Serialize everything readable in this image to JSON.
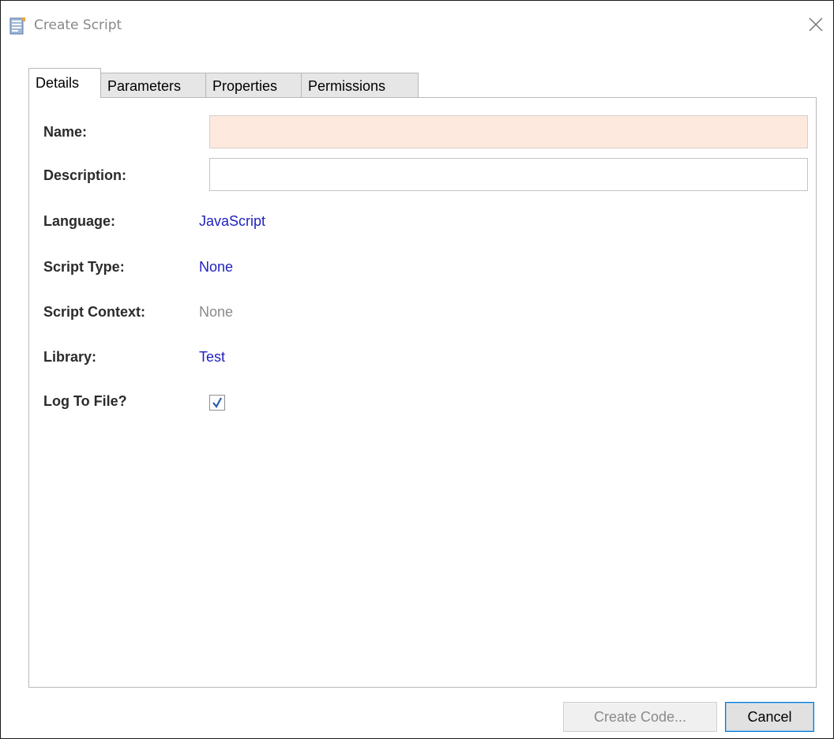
{
  "window": {
    "title": "Create Script"
  },
  "tabs": [
    "Details",
    "Parameters",
    "Properties",
    "Permissions"
  ],
  "active_tab": "Details",
  "form": {
    "name": {
      "label": "Name:",
      "value": ""
    },
    "description": {
      "label": "Description:",
      "value": ""
    },
    "language": {
      "label": "Language:",
      "value": "JavaScript"
    },
    "script_type": {
      "label": "Script Type:",
      "value": "None"
    },
    "script_context": {
      "label": "Script Context:",
      "value": "None"
    },
    "library": {
      "label": "Library:",
      "value": "Test"
    },
    "log_to_file": {
      "label": "Log To File?",
      "checked": true
    }
  },
  "buttons": {
    "create_code": "Create Code...",
    "cancel": "Cancel"
  },
  "colors": {
    "link": "#1f1fbf",
    "muted": "#8a8a8a",
    "name_field_bg": "#fde9dd",
    "check": "#2a5db0"
  },
  "icons": {
    "app": "script-document-icon",
    "close": "close-icon",
    "check": "checkmark-icon"
  }
}
